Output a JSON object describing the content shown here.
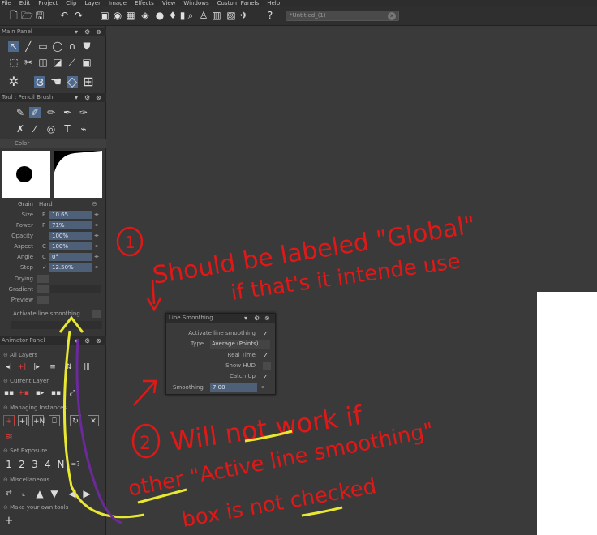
{
  "menu": [
    "File",
    "Edit",
    "Project",
    "Clip",
    "Layer",
    "Image",
    "Effects",
    "View",
    "Windows",
    "Custom Panels",
    "Help"
  ],
  "tab": {
    "title": "*Untitled_(1)",
    "close": "✕"
  },
  "main_panel": {
    "title": "Main Panel"
  },
  "tool_panel": {
    "title": "Tool : Pencil Brush",
    "color_label": "Color",
    "grain": {
      "label": "Grain",
      "value": "Hard"
    },
    "props": [
      {
        "label": "Size",
        "prefix": "P",
        "value": "10.65"
      },
      {
        "label": "Power",
        "prefix": "P",
        "value": "71%"
      },
      {
        "label": "Opacity",
        "prefix": "",
        "value": "100%"
      },
      {
        "label": "Aspect",
        "prefix": "C",
        "value": "100%"
      },
      {
        "label": "Angle",
        "prefix": "C",
        "value": "0°"
      },
      {
        "label": "Step",
        "prefix": "✓",
        "value": "12.50%"
      }
    ],
    "drying": "Drying",
    "gradient": "Gradient",
    "preview": "Preview",
    "activate_smoothing": "Activate line smoothing"
  },
  "animator_panel": {
    "title": "Animator Panel",
    "groups": [
      "All Layers",
      "Current Layer",
      "Managing Instances",
      "Set Exposure",
      "Miscellaneous",
      "Make your own tools"
    ],
    "exposure": [
      "1",
      "2",
      "3",
      "4",
      "N",
      "=?"
    ]
  },
  "dialog": {
    "title": "Line Smoothing",
    "activate_label": "Activate line smoothing",
    "type_label": "Type",
    "type_value": "Average (Points)",
    "realtime_label": "Real Time",
    "show_hud_label": "Show HUD",
    "catch_up_label": "Catch Up",
    "smoothing_label": "Smoothing",
    "smoothing_value": "7.00"
  },
  "annotations": {
    "num1": "1",
    "line1": "Should be labeled \"Global\"",
    "line2": "if that's it intende use",
    "num2": "2",
    "line3": "Will not work if",
    "line4": "other \"Active line smoothing\"",
    "line5": "box is not checked",
    "red": "#e01818",
    "yellow": "#e8e830",
    "purple": "#6a2a9a"
  },
  "colors": {
    "bg": "#3a3a3a",
    "panel": "#363636",
    "field": "#4e5f78",
    "selected": "#4f6a8f"
  }
}
